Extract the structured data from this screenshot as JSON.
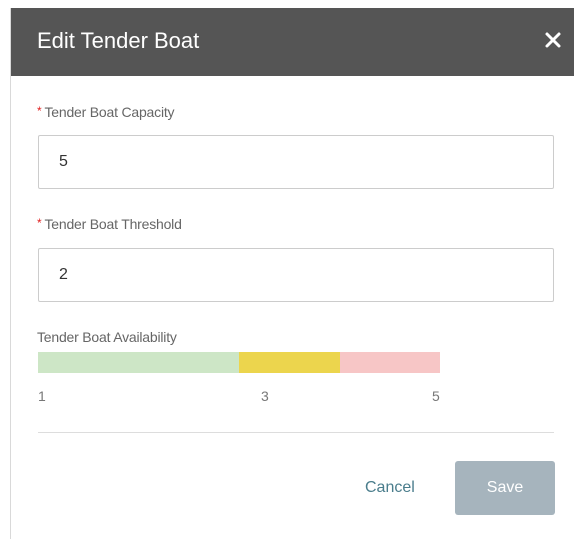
{
  "dialog": {
    "title": "Edit Tender Boat",
    "close_icon": "close-icon"
  },
  "capacity": {
    "required_marker": "*",
    "label": "Tender Boat Capacity",
    "value": "5"
  },
  "threshold": {
    "required_marker": "*",
    "label": "Tender Boat Threshold",
    "value": "2"
  },
  "availability": {
    "label": "Tender Boat Availability",
    "min": 1,
    "max": 5,
    "threshold_value": 2,
    "ticks": [
      "1",
      "3",
      "5"
    ],
    "segments": [
      {
        "name": "available",
        "from": 1,
        "to": 3,
        "color": "#cde6c6"
      },
      {
        "name": "warning",
        "from": 3,
        "to": 4,
        "color": "#ecd54d"
      },
      {
        "name": "critical",
        "from": 4,
        "to": 5,
        "color": "#f7c6c6"
      }
    ]
  },
  "actions": {
    "cancel_label": "Cancel",
    "save_label": "Save",
    "save_color": "#a6b4bd",
    "cancel_color": "#4a7d8c"
  },
  "colors": {
    "header_bg": "#555555",
    "required": "#e02020"
  }
}
